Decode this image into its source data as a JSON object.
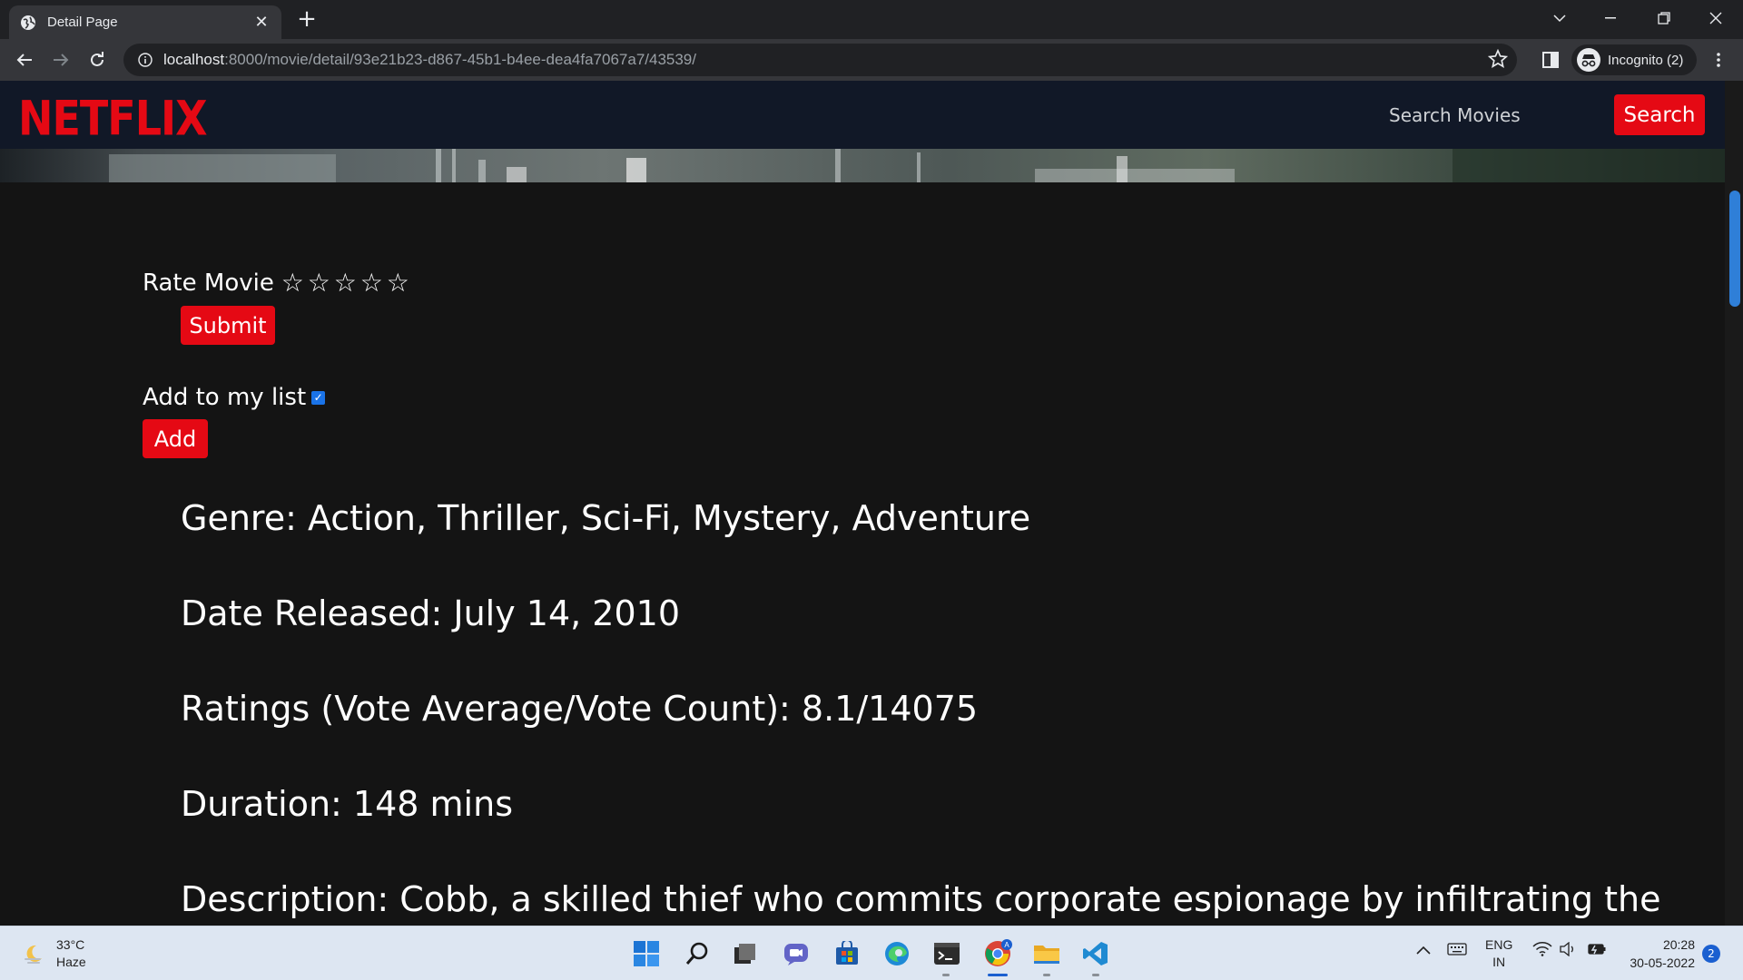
{
  "browser": {
    "tab_title": "Detail Page",
    "url_host": "localhost",
    "url_path": ":8000/movie/detail/93e21b23-d867-45b1-b4ee-dea4fa7067a7/43539/",
    "profile_label": "Incognito (2)"
  },
  "site": {
    "logo": "NETFLIX",
    "search_placeholder": "Search Movies",
    "search_button": "Search"
  },
  "rating": {
    "label": "Rate Movie",
    "stars": 0,
    "max_stars": 5,
    "submit_label": "Submit"
  },
  "my_list": {
    "label": "Add to my list",
    "checked": true,
    "add_label": "Add"
  },
  "details": {
    "genre": "Genre: Action, Thriller, Sci-Fi, Mystery, Adventure",
    "date_released": "Date Released: July 14, 2010",
    "ratings": "Ratings (Vote Average/Vote Count): 8.1/14075",
    "duration": "Duration: 148 mins",
    "description": "Description: Cobb, a skilled thief who commits corporate espionage by infiltrating the"
  },
  "taskbar": {
    "weather_temp": "33°C",
    "weather_desc": "Haze",
    "lang_top": "ENG",
    "lang_bottom": "IN",
    "time": "20:28",
    "date": "30-05-2022",
    "notifications": "2"
  },
  "colors": {
    "brand_red": "#e50914",
    "nav_bg": "#111827",
    "page_bg": "#141414",
    "checkbox_blue": "#1a73e8"
  }
}
